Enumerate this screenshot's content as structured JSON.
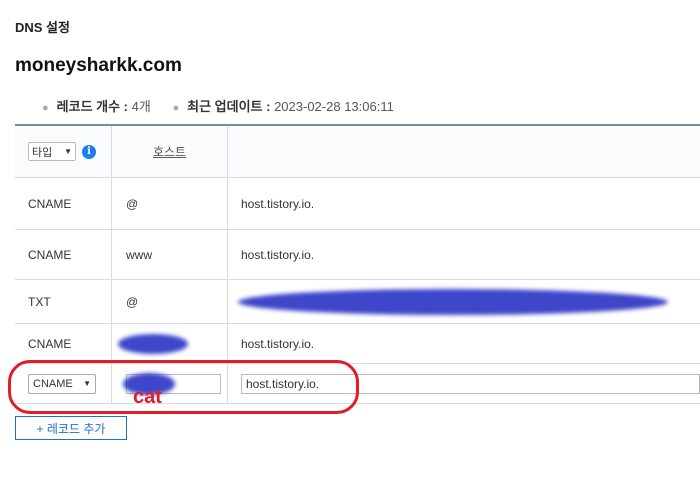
{
  "page": {
    "section_title": "DNS 설정",
    "domain": "moneysharkk.com"
  },
  "meta": {
    "record_count_label": "레코드 개수 :",
    "record_count_value": "4개",
    "updated_label": "최근 업데이트 :",
    "updated_value": "2023-02-28 13:06:11"
  },
  "table": {
    "type_filter_label": "타입",
    "host_header": "호스트",
    "rows": [
      {
        "type": "CNAME",
        "host": "@",
        "value": "host.tistory.io."
      },
      {
        "type": "CNAME",
        "host": "www",
        "value": "host.tistory.io."
      },
      {
        "type": "TXT",
        "host": "@",
        "value": ""
      },
      {
        "type": "CNAME",
        "host": "",
        "value": "host.tistory.io."
      }
    ],
    "new_row": {
      "type": "CNAME",
      "host": "",
      "value": "host.tistory.io."
    }
  },
  "annotation": {
    "label": "cat",
    "color": "#e11d2a"
  },
  "add_record_button": "+ 레코드 추가",
  "colors": {
    "accent": "#1f6fd1",
    "info": "#1c7ef0",
    "redaction": "#3e46c9"
  }
}
